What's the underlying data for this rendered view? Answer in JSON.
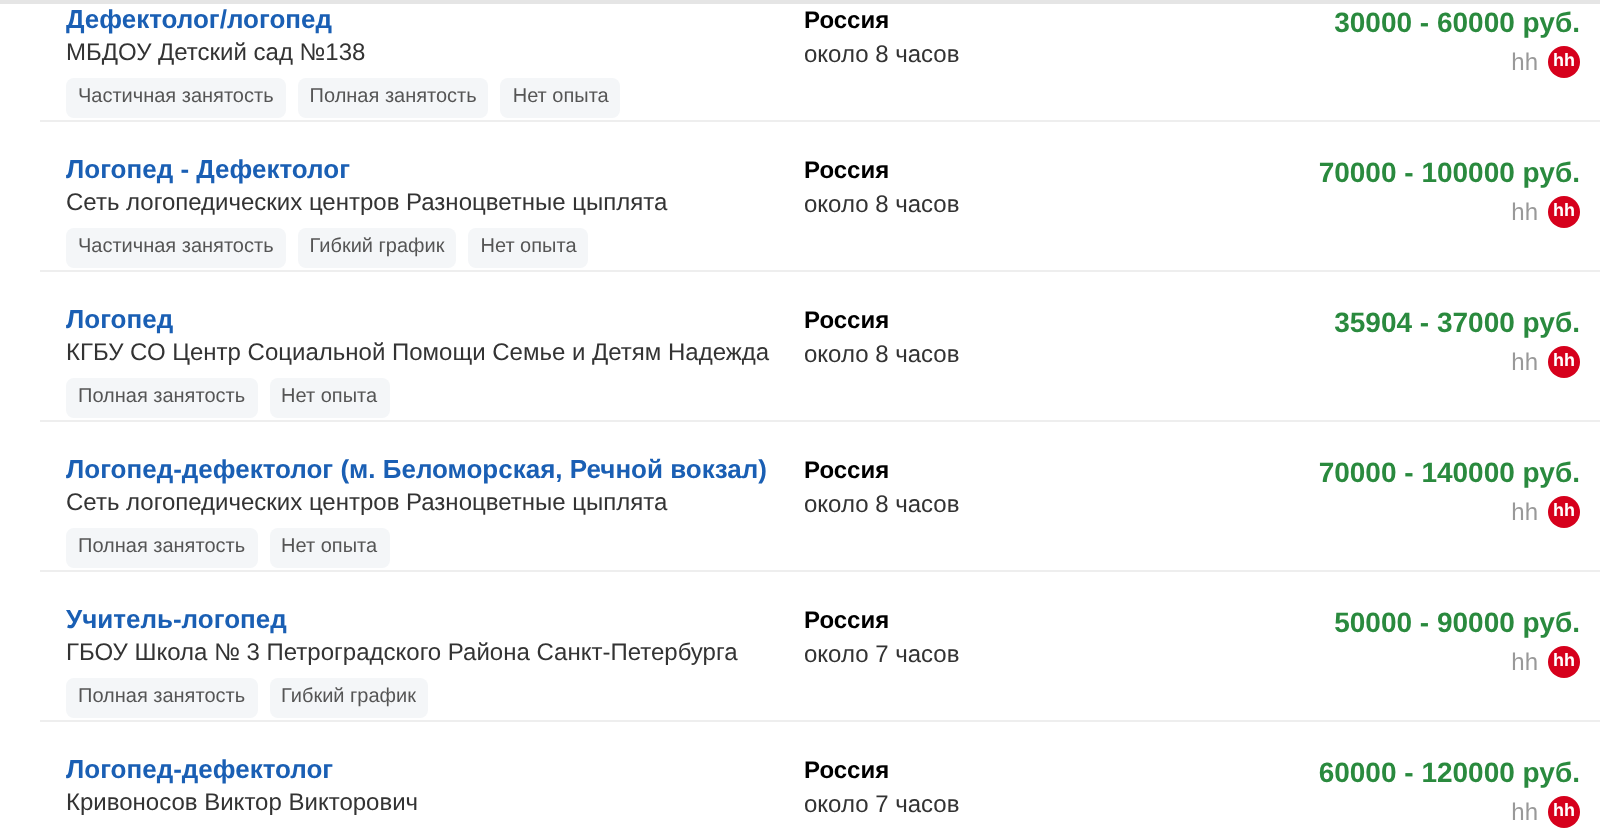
{
  "vacancies": [
    {
      "title": "Дефектолог/логопед",
      "employer": "МБДОУ Детский сад №138",
      "tags": [
        "Частичная занятость",
        "Полная занятость",
        "Нет опыта"
      ],
      "region": "Россия",
      "time": "около 8 часов",
      "salary": "30000 - 60000 руб.",
      "source": "hh",
      "logo": "hh"
    },
    {
      "title": "Логопед - Дефектолог",
      "employer": "Сеть логопедических центров Разноцветные цыплята",
      "tags": [
        "Частичная занятость",
        "Гибкий график",
        "Нет опыта"
      ],
      "region": "Россия",
      "time": "около 8 часов",
      "salary": "70000 - 100000 руб.",
      "source": "hh",
      "logo": "hh"
    },
    {
      "title": "Логопед",
      "employer": "КГБУ СО Центр Социальной Помощи Семье и Детям Надежда",
      "tags": [
        "Полная занятость",
        "Нет опыта"
      ],
      "region": "Россия",
      "time": "около 8 часов",
      "salary": "35904 - 37000 руб.",
      "source": "hh",
      "logo": "hh"
    },
    {
      "title": "Логопед-дефектолог (м. Беломорская, Речной вокзал)",
      "employer": "Сеть логопедических центров Разноцветные цыплята",
      "tags": [
        "Полная занятость",
        "Нет опыта"
      ],
      "region": "Россия",
      "time": "около 8 часов",
      "salary": "70000 - 140000 руб.",
      "source": "hh",
      "logo": "hh"
    },
    {
      "title": "Учитель-логопед",
      "employer": "ГБОУ Школа № 3 Петроградского Района Санкт-Петербурга",
      "tags": [
        "Полная занятость",
        "Гибкий график"
      ],
      "region": "Россия",
      "time": "около 7 часов",
      "salary": "50000 - 90000 руб.",
      "source": "hh",
      "logo": "hh"
    },
    {
      "title": "Логопед-дефектолог",
      "employer": "Кривоносов Виктор Викторович",
      "region": "Россия",
      "time": "около 7 часов",
      "salary": "60000 - 120000 руб.",
      "source": "hh",
      "logo": "hh"
    }
  ]
}
